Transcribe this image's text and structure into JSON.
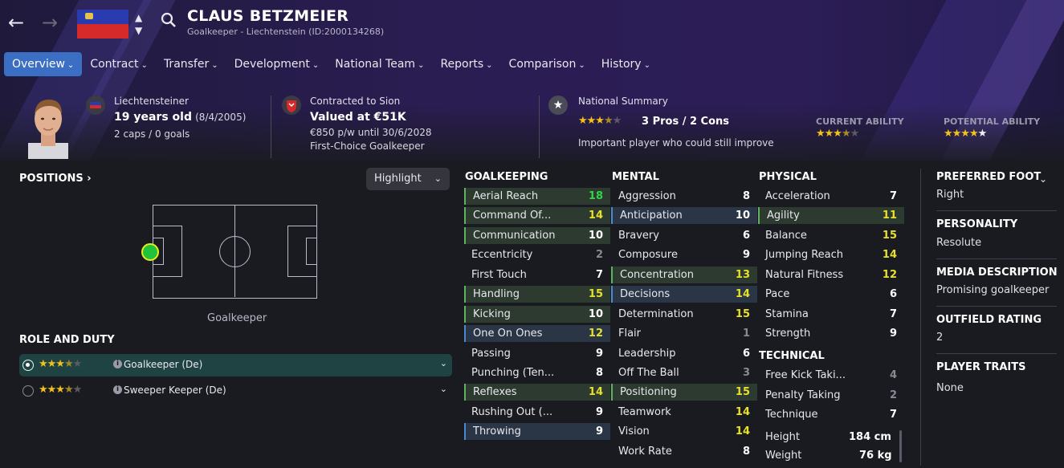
{
  "header": {
    "player_name": "CLAUS BETZMEIER",
    "subtitle": "Goalkeeper - Liechtenstein (ID:2000134268)",
    "back_icon": "arrow-left-icon",
    "forward_icon": "arrow-right-icon",
    "search_icon": "search-icon"
  },
  "tabs": [
    {
      "label": "Overview",
      "active": true
    },
    {
      "label": "Contract"
    },
    {
      "label": "Transfer"
    },
    {
      "label": "Development"
    },
    {
      "label": "National Team"
    },
    {
      "label": "Reports"
    },
    {
      "label": "Comparison"
    },
    {
      "label": "History"
    }
  ],
  "info": {
    "nationality": "Liechtensteiner",
    "age": "19 years old",
    "dob": "(8/4/2005)",
    "caps": "2 caps / 0 goals",
    "contract_label": "Contracted to Sion",
    "value": "Valued at €51K",
    "wage": "€850 p/w until 30/6/2028",
    "squad_status": "First-Choice Goalkeeper",
    "national_summary_label": "National Summary",
    "national_stars": 3.5,
    "pros_cons": "3 Pros / 2 Cons",
    "summary_text": "Important player who could still improve",
    "current_ability_label": "CURRENT ABILITY",
    "current_ability_stars": 3.5,
    "potential_ability_label": "POTENTIAL ABILITY",
    "potential_ability_stars": 5
  },
  "positions": {
    "title": "POSITIONS",
    "highlight_label": "Highlight",
    "position_label": "Goalkeeper"
  },
  "role_duty": {
    "title": "ROLE AND DUTY",
    "roles": [
      {
        "label": "Goalkeeper (De)",
        "stars": 3.5,
        "selected": true
      },
      {
        "label": "Sweeper Keeper (De)",
        "stars": 3.5,
        "selected": false
      }
    ]
  },
  "goalkeeping": {
    "title": "GOALKEEPING",
    "attrs": [
      {
        "name": "Aerial Reach",
        "value": "18"
      },
      {
        "name": "Command Of...",
        "value": "14"
      },
      {
        "name": "Communication",
        "value": "10"
      },
      {
        "name": "Eccentricity",
        "value": "2"
      },
      {
        "name": "First Touch",
        "value": "7"
      },
      {
        "name": "Handling",
        "value": "15"
      },
      {
        "name": "Kicking",
        "value": "10"
      },
      {
        "name": "One On Ones",
        "value": "12"
      },
      {
        "name": "Passing",
        "value": "9"
      },
      {
        "name": "Punching (Ten...",
        "value": "8"
      },
      {
        "name": "Reflexes",
        "value": "14"
      },
      {
        "name": "Rushing Out (...",
        "value": "9"
      },
      {
        "name": "Throwing",
        "value": "9"
      }
    ]
  },
  "mental": {
    "title": "MENTAL",
    "attrs": [
      {
        "name": "Aggression",
        "value": "8"
      },
      {
        "name": "Anticipation",
        "value": "10"
      },
      {
        "name": "Bravery",
        "value": "6"
      },
      {
        "name": "Composure",
        "value": "9"
      },
      {
        "name": "Concentration",
        "value": "13"
      },
      {
        "name": "Decisions",
        "value": "14"
      },
      {
        "name": "Determination",
        "value": "15"
      },
      {
        "name": "Flair",
        "value": "1"
      },
      {
        "name": "Leadership",
        "value": "6"
      },
      {
        "name": "Off The Ball",
        "value": "3"
      },
      {
        "name": "Positioning",
        "value": "15"
      },
      {
        "name": "Teamwork",
        "value": "14"
      },
      {
        "name": "Vision",
        "value": "14"
      },
      {
        "name": "Work Rate",
        "value": "8"
      }
    ]
  },
  "physical": {
    "title": "PHYSICAL",
    "attrs": [
      {
        "name": "Acceleration",
        "value": "7"
      },
      {
        "name": "Agility",
        "value": "11"
      },
      {
        "name": "Balance",
        "value": "15"
      },
      {
        "name": "Jumping Reach",
        "value": "14"
      },
      {
        "name": "Natural Fitness",
        "value": "12"
      },
      {
        "name": "Pace",
        "value": "6"
      },
      {
        "name": "Stamina",
        "value": "7"
      },
      {
        "name": "Strength",
        "value": "9"
      }
    ]
  },
  "technical": {
    "title": "TECHNICAL",
    "attrs": [
      {
        "name": "Free Kick Taki...",
        "value": "4"
      },
      {
        "name": "Penalty Taking",
        "value": "2"
      },
      {
        "name": "Technique",
        "value": "7"
      }
    ]
  },
  "body": {
    "height_label": "Height",
    "height": "184 cm",
    "weight_label": "Weight",
    "weight": "76 kg"
  },
  "right_panel": {
    "preferred_foot_title": "PREFERRED FOOT",
    "preferred_foot": "Right",
    "personality_title": "PERSONALITY",
    "personality": "Resolute",
    "media_title": "MEDIA DESCRIPTION",
    "media": "Promising goalkeeper",
    "outfield_title": "OUTFIELD RATING",
    "outfield": "2",
    "traits_title": "PLAYER TRAITS",
    "traits": "None"
  },
  "colors": {
    "accent": "#3a6fc4",
    "star": "#f2c21a",
    "high_value": "#34d44a",
    "good_value": "#e8e02c",
    "key_attr_green": "#2c3a30",
    "key_attr_blue": "#2a3546"
  }
}
